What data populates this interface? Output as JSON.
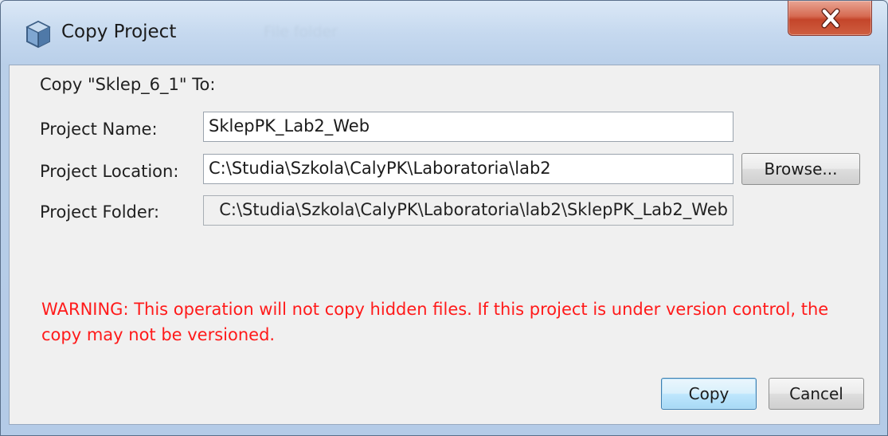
{
  "window": {
    "title": "Copy Project",
    "background_title": "File folder",
    "close_label": "X"
  },
  "dialog": {
    "heading": "Copy \"Sklep_6_1\" To:",
    "fields": {
      "project_name": {
        "label": "Project Name:",
        "value": "SklepPK_Lab2_Web"
      },
      "project_location": {
        "label": "Project Location:",
        "value": "C:\\Studia\\Szkola\\CalyPK\\Laboratoria\\lab2"
      },
      "project_folder": {
        "label": "Project Folder:",
        "value": "C:\\Studia\\Szkola\\CalyPK\\Laboratoria\\lab2\\SklepPK_Lab2_Web"
      }
    },
    "browse_label": "Browse...",
    "warning": "WARNING: This operation will not copy hidden files. If this project is under version control, the copy may not be versioned.",
    "buttons": {
      "copy": "Copy",
      "cancel": "Cancel"
    }
  },
  "colors": {
    "warning": "#ff1a1a",
    "close_button": "#c4452a",
    "default_button_border": "#3c7fb1"
  },
  "icons": {
    "title": "netbeans-cube-icon",
    "close": "close-icon"
  }
}
